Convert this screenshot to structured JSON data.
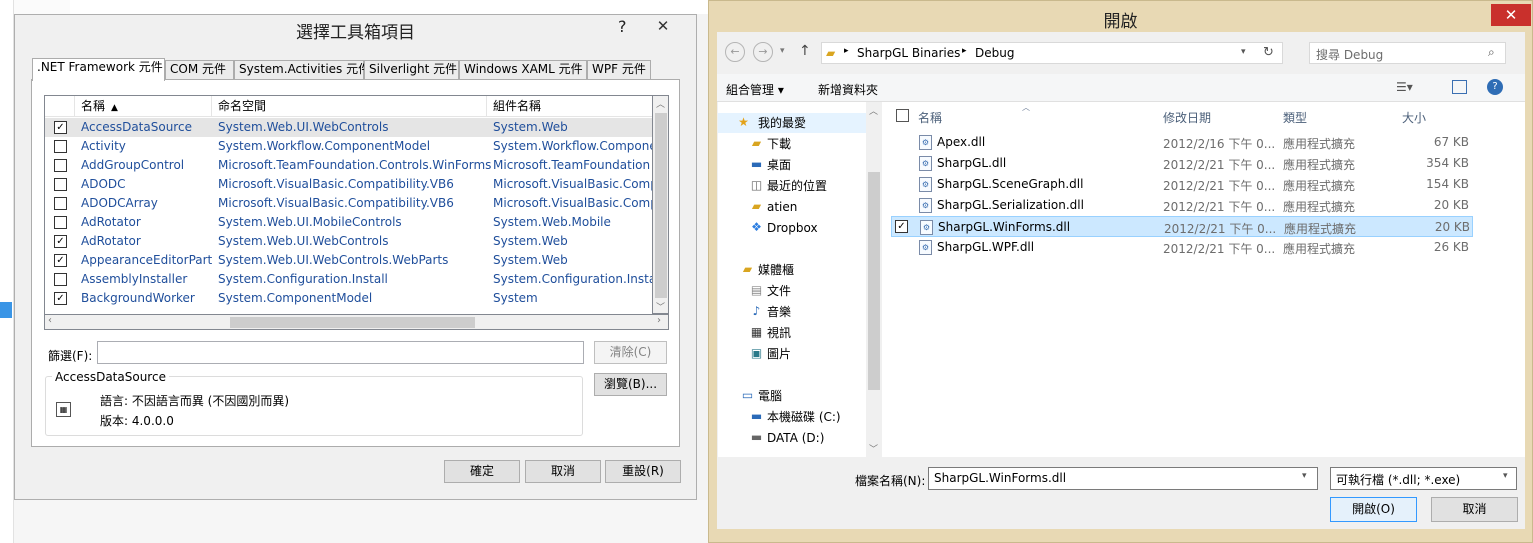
{
  "toolbox": {
    "title": "選擇工具箱項目",
    "help": "?",
    "close": "✕",
    "tabs": [
      ".NET Framework 元件",
      "COM 元件",
      "System.Activities 元件",
      "Silverlight 元件",
      "Windows XAML 元件",
      "WPF 元件"
    ],
    "columns": {
      "name": "名稱",
      "namespace": "命名空間",
      "assembly": "組件名稱"
    },
    "rows": [
      {
        "checked": true,
        "name": "AccessDataSource",
        "namespace": "System.Web.UI.WebControls",
        "assembly": "System.Web"
      },
      {
        "checked": false,
        "name": "Activity",
        "namespace": "System.Workflow.ComponentModel",
        "assembly": "System.Workflow.Componen"
      },
      {
        "checked": false,
        "name": "AddGroupControl",
        "namespace": "Microsoft.TeamFoundation.Controls.WinForms",
        "assembly": "Microsoft.TeamFoundation"
      },
      {
        "checked": false,
        "name": "ADODC",
        "namespace": "Microsoft.VisualBasic.Compatibility.VB6",
        "assembly": "Microsoft.VisualBasic.Comp"
      },
      {
        "checked": false,
        "name": "ADODCArray",
        "namespace": "Microsoft.VisualBasic.Compatibility.VB6",
        "assembly": "Microsoft.VisualBasic.Comp"
      },
      {
        "checked": false,
        "name": "AdRotator",
        "namespace": "System.Web.UI.MobileControls",
        "assembly": "System.Web.Mobile"
      },
      {
        "checked": true,
        "name": "AdRotator",
        "namespace": "System.Web.UI.WebControls",
        "assembly": "System.Web"
      },
      {
        "checked": true,
        "name": "AppearanceEditorPart",
        "namespace": "System.Web.UI.WebControls.WebParts",
        "assembly": "System.Web"
      },
      {
        "checked": false,
        "name": "AssemblyInstaller",
        "namespace": "System.Configuration.Install",
        "assembly": "System.Configuration.Instal"
      },
      {
        "checked": true,
        "name": "BackgroundWorker",
        "namespace": "System.ComponentModel",
        "assembly": "System"
      }
    ],
    "filter_label": "篩選(F):",
    "filter_value": "",
    "clear_label": "清除(C)",
    "browse_label": "瀏覽(B)...",
    "info_title": "AccessDataSource",
    "info_language": "語言:  不因語言而異 (不因國別而異)",
    "info_version": "版本:  4.0.0.0",
    "ok_label": "確定",
    "cancel_label": "取消",
    "reset_label": "重設(R)"
  },
  "open": {
    "title": "開啟",
    "close": "✕",
    "breadcrumb": [
      "SharpGL Binaries",
      "Debug"
    ],
    "search_placeholder": "搜尋 Debug",
    "organize_label": "組合管理 ▾",
    "new_folder_label": "新增資料夾",
    "nav": {
      "favorites": "我的最愛",
      "downloads": "下載",
      "desktop": "桌面",
      "recent": "最近的位置",
      "atien": "atien",
      "dropbox": "Dropbox",
      "libraries": "媒體櫃",
      "documents": "文件",
      "music": "音樂",
      "videos": "視訊",
      "pictures": "圖片",
      "computer": "電腦",
      "local_disk": "本機磁碟 (C:)",
      "data_disk": "DATA (D:)"
    },
    "columns": {
      "name": "名稱",
      "date": "修改日期",
      "type": "類型",
      "size": "大小"
    },
    "files": [
      {
        "name": "Apex.dll",
        "date": "2012/2/16 下午 0...",
        "type": "應用程式擴充",
        "size": "67 KB",
        "selected": false
      },
      {
        "name": "SharpGL.dll",
        "date": "2012/2/21 下午 0...",
        "type": "應用程式擴充",
        "size": "354 KB",
        "selected": false
      },
      {
        "name": "SharpGL.SceneGraph.dll",
        "date": "2012/2/21 下午 0...",
        "type": "應用程式擴充",
        "size": "154 KB",
        "selected": false
      },
      {
        "name": "SharpGL.Serialization.dll",
        "date": "2012/2/21 下午 0...",
        "type": "應用程式擴充",
        "size": "20 KB",
        "selected": false
      },
      {
        "name": "SharpGL.WinForms.dll",
        "date": "2012/2/21 下午 0...",
        "type": "應用程式擴充",
        "size": "20 KB",
        "selected": true
      },
      {
        "name": "SharpGL.WPF.dll",
        "date": "2012/2/21 下午 0...",
        "type": "應用程式擴充",
        "size": "26 KB",
        "selected": false
      }
    ],
    "filename_label": "檔案名稱(N):",
    "filename_value": "SharpGL.WinForms.dll",
    "filetype_value": "可執行檔 (*.dll; *.exe)",
    "open_label": "開啟(O)",
    "cancel_label": "取消"
  },
  "colors": {
    "accent": "#3399ff",
    "selection": "#cce8ff",
    "open_frame": "#e8d9b4",
    "close_red": "#c9302c"
  }
}
